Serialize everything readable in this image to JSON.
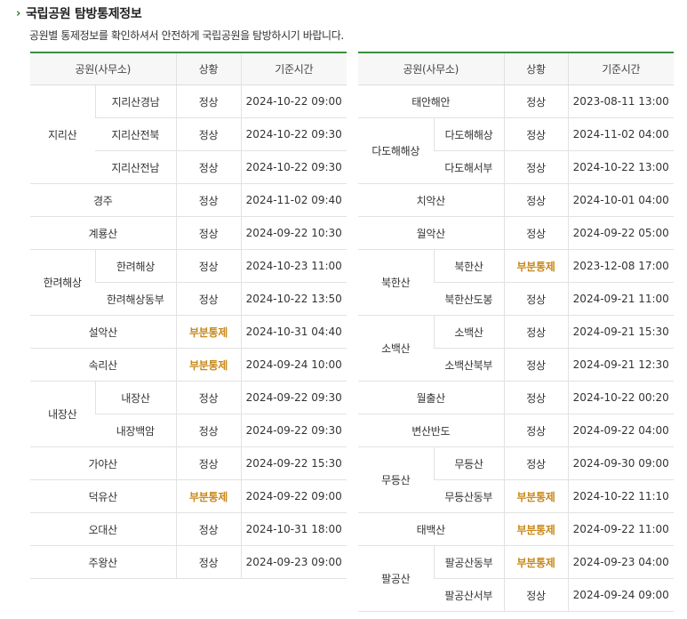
{
  "page": {
    "title": "국립공원 탐방통제정보",
    "description": "공원별 통제정보를 확인하셔서 안전하게 국립공원을 탐방하시기 바랍니다."
  },
  "headers": {
    "park": "공원(사무소)",
    "status": "상황",
    "time": "기준시간"
  },
  "colors": {
    "accent": "#3b8f3e",
    "partial_status": "#c8891a"
  },
  "left_table": [
    {
      "park": "지리산",
      "offices": [
        {
          "name": "지리산경남",
          "status": "정상",
          "time": "2024-10-22 09:00"
        },
        {
          "name": "지리산전북",
          "status": "정상",
          "time": "2024-10-22 09:30"
        },
        {
          "name": "지리산전남",
          "status": "정상",
          "time": "2024-10-22 09:30"
        }
      ]
    },
    {
      "park": "경주",
      "status": "정상",
      "time": "2024-11-02 09:40"
    },
    {
      "park": "계룡산",
      "status": "정상",
      "time": "2024-09-22 10:30"
    },
    {
      "park": "한려해상",
      "offices": [
        {
          "name": "한려해상",
          "status": "정상",
          "time": "2024-10-23 11:00"
        },
        {
          "name": "한려해상동부",
          "status": "정상",
          "time": "2024-10-22 13:50"
        }
      ]
    },
    {
      "park": "설악산",
      "status": "부분통제",
      "time": "2024-10-31 04:40"
    },
    {
      "park": "속리산",
      "status": "부분통제",
      "time": "2024-09-24 10:00"
    },
    {
      "park": "내장산",
      "offices": [
        {
          "name": "내장산",
          "status": "정상",
          "time": "2024-09-22 09:30"
        },
        {
          "name": "내장백암",
          "status": "정상",
          "time": "2024-09-22 09:30"
        }
      ]
    },
    {
      "park": "가야산",
      "status": "정상",
      "time": "2024-09-22 15:30"
    },
    {
      "park": "덕유산",
      "status": "부분통제",
      "time": "2024-09-22 09:00"
    },
    {
      "park": "오대산",
      "status": "정상",
      "time": "2024-10-31 18:00"
    },
    {
      "park": "주왕산",
      "status": "정상",
      "time": "2024-09-23 09:00"
    }
  ],
  "right_table": [
    {
      "park": "태안해안",
      "status": "정상",
      "time": "2023-08-11 13:00"
    },
    {
      "park": "다도해해상",
      "offices": [
        {
          "name": "다도해해상",
          "status": "정상",
          "time": "2024-11-02 04:00"
        },
        {
          "name": "다도해서부",
          "status": "정상",
          "time": "2024-10-22 13:00"
        }
      ]
    },
    {
      "park": "치악산",
      "status": "정상",
      "time": "2024-10-01 04:00"
    },
    {
      "park": "월악산",
      "status": "정상",
      "time": "2024-09-22 05:00"
    },
    {
      "park": "북한산",
      "offices": [
        {
          "name": "북한산",
          "status": "부분통제",
          "time": "2023-12-08 17:00"
        },
        {
          "name": "북한산도봉",
          "status": "정상",
          "time": "2024-09-21 11:00"
        }
      ]
    },
    {
      "park": "소백산",
      "offices": [
        {
          "name": "소백산",
          "status": "정상",
          "time": "2024-09-21 15:30"
        },
        {
          "name": "소백산북부",
          "status": "정상",
          "time": "2024-09-21 12:30"
        }
      ]
    },
    {
      "park": "월출산",
      "status": "정상",
      "time": "2024-10-22 00:20"
    },
    {
      "park": "변산반도",
      "status": "정상",
      "time": "2024-09-22 04:00"
    },
    {
      "park": "무등산",
      "offices": [
        {
          "name": "무등산",
          "status": "정상",
          "time": "2024-09-30 09:00"
        },
        {
          "name": "무등산동부",
          "status": "부분통제",
          "time": "2024-10-22 11:10"
        }
      ]
    },
    {
      "park": "태백산",
      "status": "부분통제",
      "time": "2024-09-22 11:00"
    },
    {
      "park": "팔공산",
      "offices": [
        {
          "name": "팔공산동부",
          "status": "부분통제",
          "time": "2024-09-23 04:00"
        },
        {
          "name": "팔공산서부",
          "status": "정상",
          "time": "2024-09-24 09:00"
        }
      ]
    }
  ]
}
